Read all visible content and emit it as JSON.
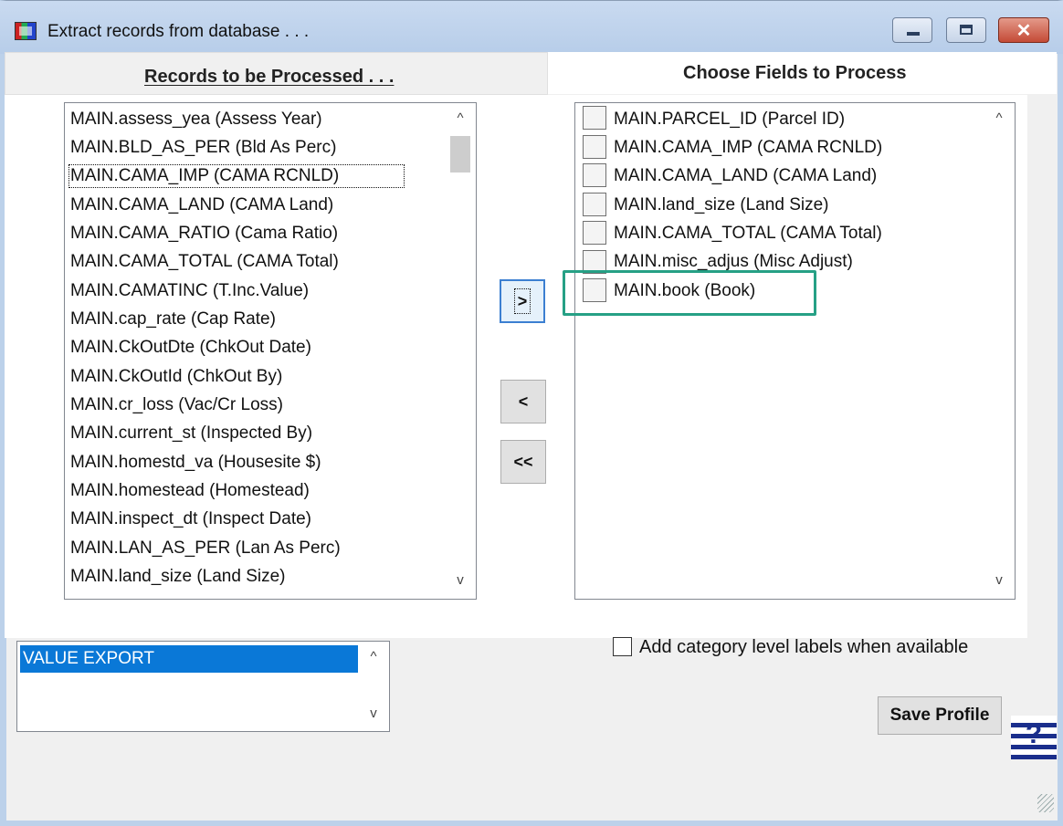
{
  "window": {
    "title": "Extract records from database . . ."
  },
  "tabs": {
    "left_header": "Records to be Processed . . .",
    "right_header": "Choose Fields to Process"
  },
  "left_list": {
    "items": [
      "MAIN.assess_yea (Assess Year)",
      "MAIN.BLD_AS_PER (Bld As Perc)",
      "MAIN.CAMA_IMP (CAMA RCNLD)",
      "MAIN.CAMA_LAND (CAMA Land)",
      "MAIN.CAMA_RATIO (Cama Ratio)",
      "MAIN.CAMA_TOTAL (CAMA Total)",
      "MAIN.CAMATINC (T.Inc.Value)",
      "MAIN.cap_rate (Cap Rate)",
      "MAIN.CkOutDte (ChkOut Date)",
      "MAIN.CkOutId (ChkOut By)",
      "MAIN.cr_loss (Vac/Cr Loss)",
      "MAIN.current_st (Inspected By)",
      "MAIN.homestd_va (Housesite $)",
      "MAIN.homestead (Homestead)",
      "MAIN.inspect_dt (Inspect Date)",
      "MAIN.LAN_AS_PER (Lan As Perc)",
      "MAIN.land_size (Land Size)"
    ]
  },
  "right_list": {
    "items": [
      "MAIN.PARCEL_ID (Parcel ID)",
      "MAIN.CAMA_IMP (CAMA RCNLD)",
      "MAIN.CAMA_LAND (CAMA Land)",
      "MAIN.land_size (Land Size)",
      "MAIN.CAMA_TOTAL (CAMA Total)",
      "MAIN.misc_adjus (Misc Adjust)",
      "MAIN.book (Book)"
    ]
  },
  "move_buttons": {
    "add": ">",
    "remove": "<",
    "remove_all": "<<"
  },
  "profile_list": {
    "selected": "VALUE EXPORT"
  },
  "options": {
    "category_labels": "Add category level labels when available"
  },
  "actions": {
    "save_profile": "Save Profile"
  },
  "scroll_glyphs": {
    "up": "^",
    "down": "v"
  },
  "colors": {
    "highlight": "#26a085",
    "selection": "#0a78d7"
  }
}
